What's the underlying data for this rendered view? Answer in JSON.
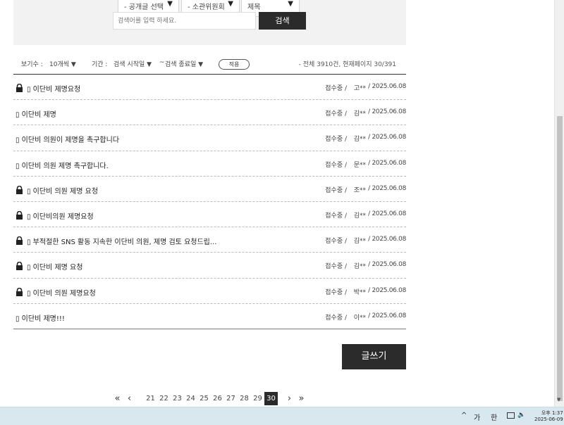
{
  "search": {
    "select1": "- 공개글 선택",
    "select2": "- 소관위원회",
    "select3": "제목",
    "placeholder": "검색어를 입력 하세요.",
    "button": "검색"
  },
  "filters": {
    "per_page_label": "보기수 :",
    "per_page_value": "10개씩",
    "period_label": "기간 :",
    "start_placeholder": "검색 시작일",
    "tilde": "~",
    "end_placeholder": "검색 종료일",
    "apply": "적용",
    "summary": "- 전체 3910건, 현재페이지 30/391",
    "arrow": "▼"
  },
  "posts": [
    {
      "locked": true,
      "title": "▯ 이단비 제명요청",
      "status": "접수중 /",
      "author": "고**",
      "date": "/ 2025.06.08"
    },
    {
      "locked": false,
      "title": "▯ 이단비 제명",
      "status": "접수중 /",
      "author": "김**",
      "date": "/ 2025.06.08"
    },
    {
      "locked": false,
      "title": "▯ 이단비 의원이 제명을 촉구합니다",
      "status": "접수중 /",
      "author": "김**",
      "date": "/ 2025.06.08"
    },
    {
      "locked": false,
      "title": "▯ 이단비 의원 제명 촉구합니다.",
      "status": "접수중 /",
      "author": "문**",
      "date": "/ 2025.06.08"
    },
    {
      "locked": true,
      "title": "▯ 이단비 의원 제명 요청",
      "status": "접수중 /",
      "author": "조**",
      "date": "/ 2025.06.08"
    },
    {
      "locked": true,
      "title": "▯ 이단비의원 제명요청",
      "status": "접수중 /",
      "author": "김**",
      "date": "/ 2025.06.08"
    },
    {
      "locked": true,
      "title": "▯ 부적절한 SNS 활동 지속한 이단비 의원, 제명 검토 요청드립...",
      "status": "접수중 /",
      "author": "김**",
      "date": "/ 2025.06.08"
    },
    {
      "locked": true,
      "title": "▯ 이단비 제명 요청",
      "status": "접수중 /",
      "author": "김**",
      "date": "/ 2025.06.08"
    },
    {
      "locked": true,
      "title": "▯ 이단비 의원 제명요청",
      "status": "접수중 /",
      "author": "박**",
      "date": "/ 2025.06.08"
    },
    {
      "locked": false,
      "title": "▯ 이단비 제명!!!",
      "status": "접수중 /",
      "author": "이**",
      "date": "/ 2025.06.08"
    }
  ],
  "write_button": "글쓰기",
  "pagination": {
    "first": "«",
    "prev": "‹",
    "pages": [
      "21",
      "22",
      "23",
      "24",
      "25",
      "26",
      "27",
      "28",
      "29",
      "30"
    ],
    "current": "30",
    "next": "›",
    "last": "»"
  },
  "taskbar": {
    "caret": "^",
    "ime1": "가",
    "ime2": "한",
    "volume": "🔈",
    "time": "오후 1:37",
    "date": "2025-06-09"
  },
  "colors": {
    "dark_button": "#2b2b2b",
    "panel_bg": "#f2f2f2",
    "taskbar_bg": "#d9e8ef"
  }
}
